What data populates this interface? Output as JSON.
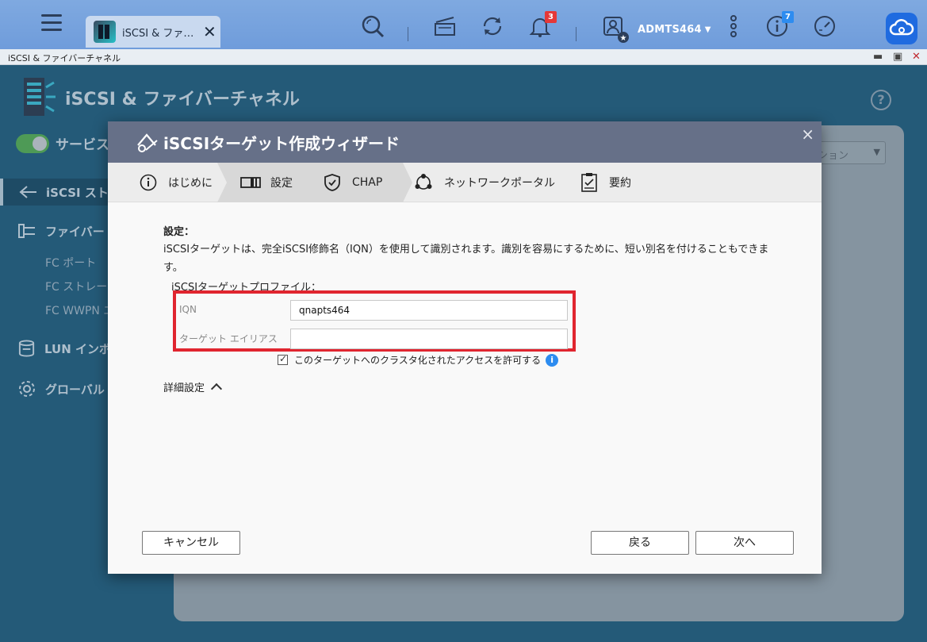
{
  "taskbar": {
    "tab_label": "iSCSI & ファ…",
    "notification_count": "3",
    "user_name": "ADMTS464",
    "info_count": "7"
  },
  "window": {
    "title": "iSCSI & ファイバーチャネル"
  },
  "app": {
    "title": "iSCSI & ファイバーチャネル",
    "service_label": "サービス",
    "sidebar": {
      "iscsi_storage": "iSCSI スト",
      "fibre_channel": "ファイバー",
      "fc_port": "FC ポート",
      "fc_storage": "FC ストレー",
      "fc_wwpn": "FC WWPN エ",
      "lun_import": "LUN インポ",
      "global": "グローバル"
    },
    "panel_select_value": "ション"
  },
  "dialog": {
    "title": "iSCSIターゲット作成ウィザード",
    "steps": [
      {
        "label": "はじめに"
      },
      {
        "label": "設定"
      },
      {
        "label": "CHAP"
      },
      {
        "label": "ネットワークポータル"
      },
      {
        "label": "要約"
      }
    ],
    "section_title": "設定：",
    "description": "iSCSIターゲットは、完全iSCSI修飾名（IQN）を使用して識別されます。識別を容易にするために、短い別名を付けることもできます。",
    "profile_label": "iSCSIターゲットプロファイル：",
    "iqn_label": "IQN",
    "iqn_value": "qnapts464",
    "alias_label": "ターゲット エイリアス",
    "alias_value": "",
    "cluster_checkbox_label": "このターゲットへのクラスタ化されたアクセスを許可する",
    "cluster_checked": true,
    "advanced_label": "詳細設定",
    "cancel_label": "キャンセル",
    "back_label": "戻る",
    "next_label": "次へ"
  },
  "colors": {
    "taskbar": "#6f9cdb",
    "dialog_header": "#667088",
    "highlight_box": "#e0252f",
    "app_background": "#245a78"
  }
}
